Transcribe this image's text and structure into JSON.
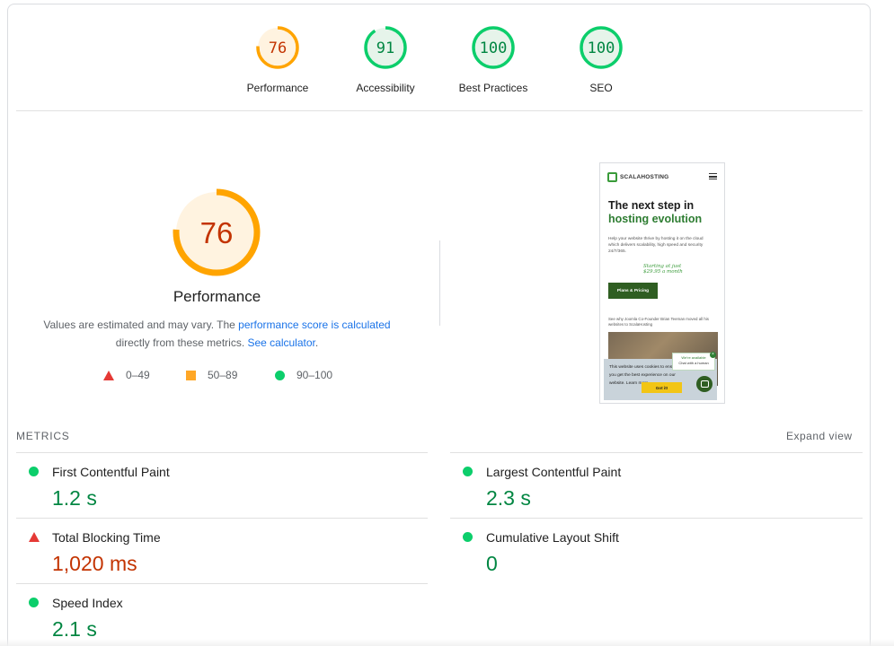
{
  "scores": [
    {
      "value": "76",
      "label": "Performance",
      "score": 0.76,
      "ring_color": "#ffa400",
      "text_color": "#c33300",
      "fill": "#fff3e0"
    },
    {
      "value": "91",
      "label": "Accessibility",
      "score": 0.91,
      "ring_color": "#0cce6b",
      "text_color": "#018642",
      "fill": "#e6f4ea"
    },
    {
      "value": "100",
      "label": "Best Practices",
      "score": 1.0,
      "ring_color": "#0cce6b",
      "text_color": "#018642",
      "fill": "#e6f4ea"
    },
    {
      "value": "100",
      "label": "SEO",
      "score": 1.0,
      "ring_color": "#0cce6b",
      "text_color": "#018642",
      "fill": "#e6f4ea"
    }
  ],
  "performance": {
    "score": "76",
    "score_fraction": 0.76,
    "title": "Performance",
    "desc_prefix": "Values are estimated and may vary. The ",
    "desc_link": "performance score is calculated",
    "desc_mid": " directly from these metrics. ",
    "desc_calc_link": "See calculator",
    "desc_suffix": "."
  },
  "legend": {
    "fail": "0–49",
    "average": "50–89",
    "pass": "90–100"
  },
  "screenshot": {
    "logo": "SCALAHOSTING",
    "headline_1": "The next step in",
    "headline_2": "hosting evolution",
    "body": "Help your website thrive by hosting it on the cloud which delivers scalability, high speed and security 24/7/365.",
    "note": "Starting at just $29.95 a month",
    "cta": "Plans & Pricing",
    "cofounder": "See why Joomla Co-Founder Brian Teeman moved all his websites to ScalaHosting",
    "cookie_text": "This website uses cookies to ensure you get the best experience on our website. Learn more",
    "got_it": "Got it!",
    "chat_1": "We're available",
    "chat_2": "Chat with a human"
  },
  "metrics": {
    "header": "METRICS",
    "expand": "Expand view",
    "items": [
      {
        "label": "First Contentful Paint",
        "value": "1.2 s",
        "status": "pass"
      },
      {
        "label": "Largest Contentful Paint",
        "value": "2.3 s",
        "status": "pass"
      },
      {
        "label": "Total Blocking Time",
        "value": "1,020 ms",
        "status": "fail"
      },
      {
        "label": "Cumulative Layout Shift",
        "value": "0",
        "status": "pass"
      },
      {
        "label": "Speed Index",
        "value": "2.1 s",
        "status": "pass"
      }
    ]
  },
  "colors": {
    "pass": "#0cce6b",
    "average": "#ffa400",
    "fail": "#ff4e42",
    "link": "#1a73e8"
  }
}
